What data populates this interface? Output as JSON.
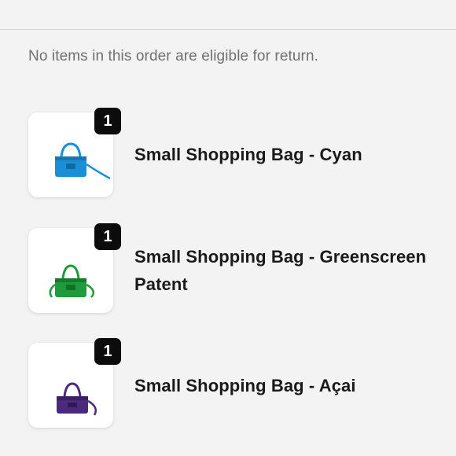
{
  "order": {
    "return_notice": "No items in this order are eligible for return."
  },
  "items": [
    {
      "quantity": "1",
      "title": "Small Shopping Bag - Cyan",
      "color": "#1a8fd6",
      "icon": "cyan-bag-thumbnail"
    },
    {
      "quantity": "1",
      "title": "Small Shopping Bag - Greenscreen Patent",
      "color": "#1f9a3c",
      "icon": "green-bag-thumbnail"
    },
    {
      "quantity": "1",
      "title": "Small Shopping Bag - Açai",
      "color": "#4a2a7a",
      "icon": "purple-bag-thumbnail"
    }
  ]
}
